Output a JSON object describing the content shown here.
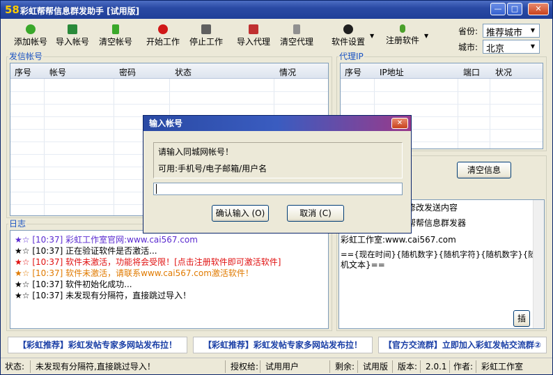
{
  "window": {
    "logo": "58",
    "title": "彩虹帮帮信息群发助手 [试用版]",
    "controls": {
      "minimize": "—",
      "maximize": "□",
      "close": "✕"
    }
  },
  "toolbar": {
    "items": [
      {
        "label": "添加帐号",
        "icon": "add-icon",
        "color": "#3aa82a"
      },
      {
        "label": "导入帐号",
        "icon": "import-icon",
        "color": "#2a8a3a"
      },
      {
        "label": "清空帐号",
        "icon": "trash-icon",
        "color": "#3aa82a"
      },
      {
        "label": "开始工作",
        "icon": "play-icon",
        "color": "#d01818"
      },
      {
        "label": "停止工作",
        "icon": "stop-icon",
        "color": "#606060"
      },
      {
        "label": "导入代理",
        "icon": "import-proxy-icon",
        "color": "#c03030"
      },
      {
        "label": "清空代理",
        "icon": "trash-icon",
        "color": "#909090"
      },
      {
        "label": "软件设置",
        "icon": "info-icon",
        "color": "#202020"
      },
      {
        "label": "注册软件",
        "icon": "key-icon",
        "color": "#4aa02a"
      }
    ],
    "dropdown_caret": "▼"
  },
  "location": {
    "province_label": "省份:",
    "province_value": "推荐城市",
    "city_label": "城市:",
    "city_value": "北京"
  },
  "accounts": {
    "group_title": "发信帐号",
    "columns": [
      "序号",
      "帐号",
      "密码",
      "状态",
      "情况"
    ]
  },
  "proxy": {
    "group_title": "代理IP",
    "columns": [
      "序号",
      "IP地址",
      "端口",
      "状况"
    ]
  },
  "log": {
    "group_title": "日志",
    "lines": [
      {
        "star": "★☆",
        "star_color": "#5a2ad0",
        "time": "[10:37]",
        "text": "彩虹工作室官网:www.cai567.com",
        "color": "#5a2ad0"
      },
      {
        "star": "★☆",
        "star_color": "#000000",
        "time": "[10:37]",
        "text": "正在验证软件是否激活...",
        "color": "#000000"
      },
      {
        "star": "★☆",
        "star_color": "#e01010",
        "time": "[10:37]",
        "text": "软件未激活，功能将会受限！[点击注册软件即可激活软件]",
        "color": "#e01010"
      },
      {
        "star": "★☆",
        "star_color": "#e07a00",
        "time": "[10:37]",
        "text": "软件未激活，请联系www.cai567.com激活软件！",
        "color": "#e07a00"
      },
      {
        "star": "★☆",
        "star_color": "#000000",
        "time": "[10:37]",
        "text": "软件初始化成功...",
        "color": "#000000"
      },
      {
        "star": "★☆",
        "star_color": "#000000",
        "time": "[10:37]",
        "text": "未发现有分隔符，直接跳过导入！",
        "color": "#000000"
      }
    ]
  },
  "content": {
    "clear_info_button": "清空信息",
    "text_lines": [
      "修改发送内容",
      "帮帮信息群发器",
      "彩虹工作室:www.cai567.com",
      "=={现在时间}{随机数字}{随机字符}{随机数字}{随",
      "机文本}=="
    ],
    "insert_button": "插"
  },
  "banners": [
    "【彩虹推荐】彩虹发帖专家多网站发布拉！",
    "【彩虹推荐】彩虹发帖专家多网站发布拉！",
    "【官方交流群】立即加入彩虹发帖交流群②"
  ],
  "status": {
    "state_label": "状态:",
    "state_value": "未发现有分隔符,直接跳过导入！",
    "auth_label": "授权给:",
    "auth_value": "试用用户",
    "remain_label": "剩余:",
    "remain_value": "试用版",
    "version_label": "版本:",
    "version_value": "2.0.1",
    "author_label": "作者:",
    "author_value": "彩虹工作室"
  },
  "dialog": {
    "title": "输入帐号",
    "prompt": "请输入同城网帐号！",
    "hint": "可用:手机号/电子邮箱/用户名",
    "input_value": "",
    "ok_button": "确认输入 (O)",
    "cancel_button": "取消 (C)",
    "close": "✕"
  }
}
